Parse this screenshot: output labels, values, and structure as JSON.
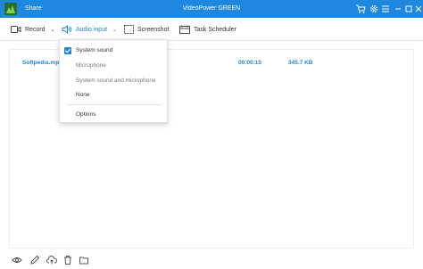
{
  "app": {
    "title": "VideoPower GREEN",
    "share_label": "Share"
  },
  "titlebar_icons": [
    "cart-icon",
    "gear-icon",
    "menu-icon",
    "minimize-icon",
    "maximize-icon",
    "close-icon"
  ],
  "toolbar": {
    "record_label": "Record",
    "audio_input_label": "Audio input",
    "screenshot_label": "Screenshot",
    "task_scheduler_label": "Task Scheduler"
  },
  "recordings": [
    {
      "name": "Softpedia.mp4",
      "duration": "00:00:15",
      "size": "345.7 KB"
    }
  ],
  "audio_menu": {
    "items": [
      {
        "label": "System sound",
        "selected": true
      },
      {
        "label": "Microphone",
        "selected": false
      },
      {
        "label": "System sound and microphone",
        "selected": false
      },
      {
        "label": "None",
        "selected": false
      }
    ],
    "options_label": "Options"
  },
  "bottom_icons": [
    "eye-icon",
    "edit-icon",
    "cloud-upload-icon",
    "trash-icon",
    "folder-icon"
  ],
  "colors": {
    "accent": "#1e87e0",
    "titlebar": "#1e87e0"
  }
}
